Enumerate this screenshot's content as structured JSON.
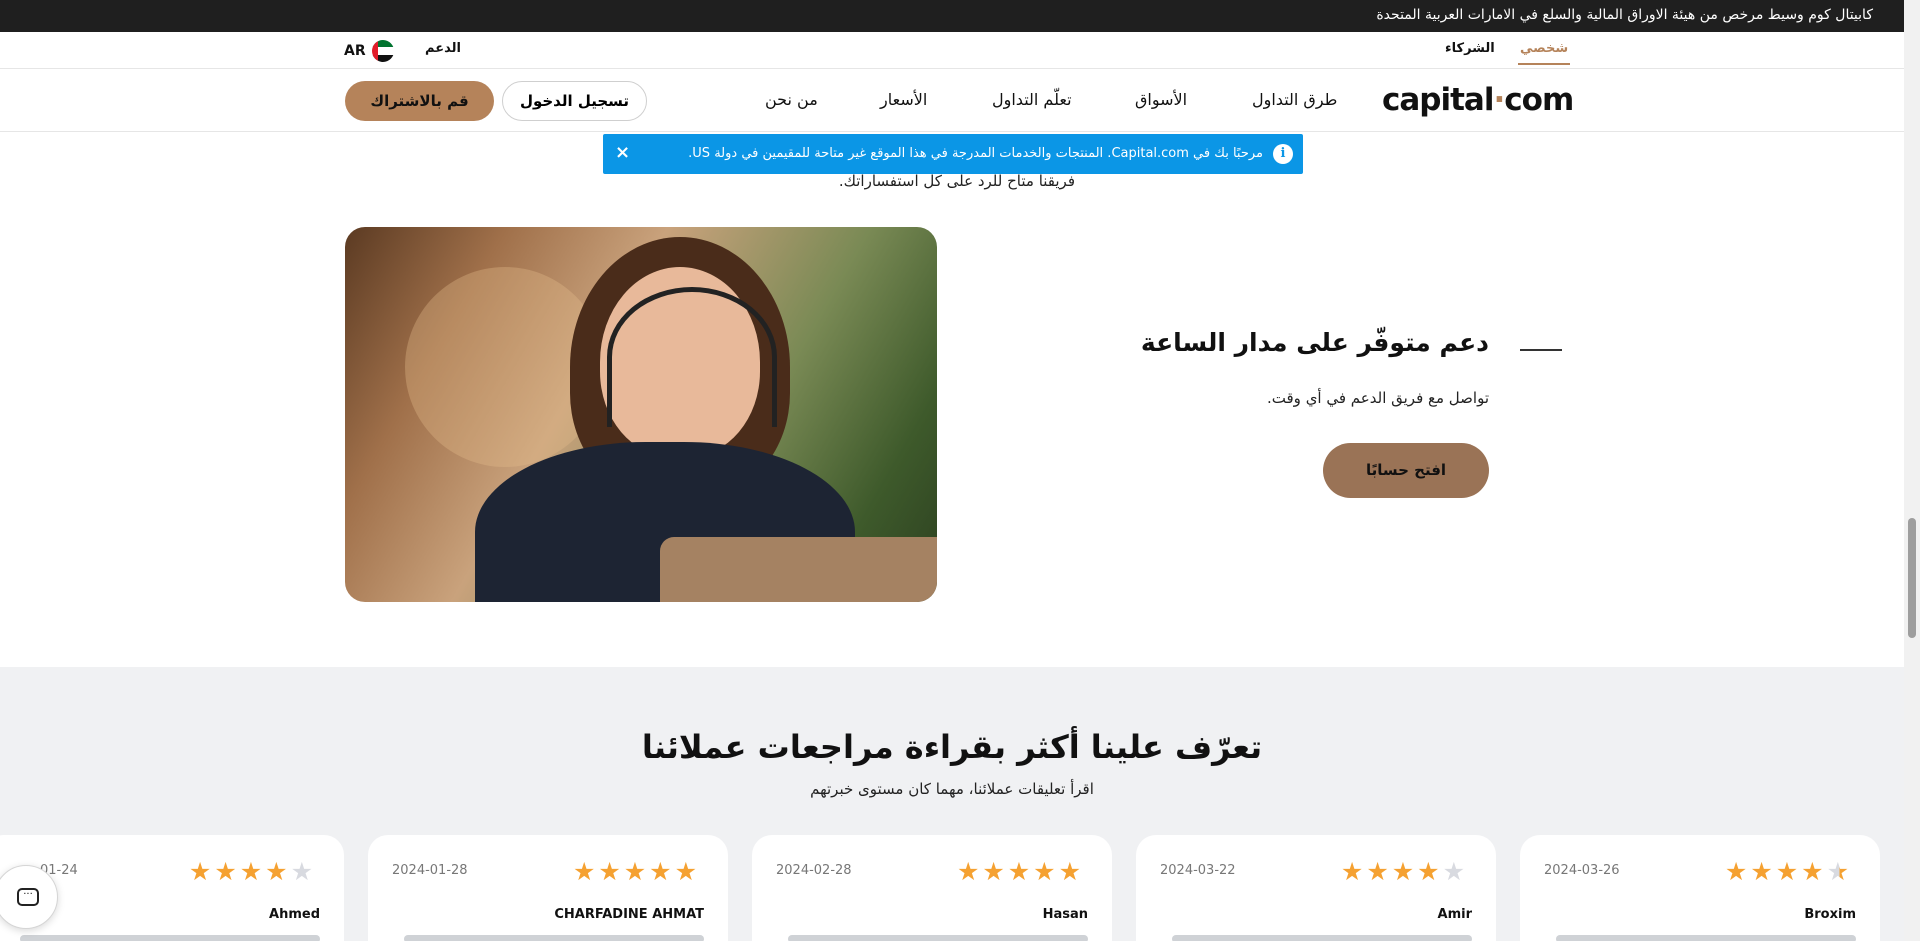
{
  "topbar": {
    "text": "كابيتال كوم وسيط مرخص من هيئة الاوراق المالية والسلع في الامارات العربية المتحدة"
  },
  "subnav": {
    "personal": "شخصي",
    "partners": "الشركاء",
    "support": "الدعم",
    "lang": "AR"
  },
  "nav": {
    "logo_left": "capital",
    "logo_dot": "·",
    "logo_right": "com",
    "items": [
      "طرق التداول",
      "الأسواق",
      "تعلّم التداول",
      "الأسعار",
      "من نحن"
    ],
    "login": "تسجيل الدخول",
    "signup": "قم بالاشتراك"
  },
  "info_banner": {
    "message": "مرحبًا بك في Capital.com. المنتجات والخدمات المدرجة في هذا الموقع غير متاحة للمقيمين في دولة US.",
    "close": "×"
  },
  "lead_text": "فريقنا متاح للرد على كل استفساراتك.",
  "support_section": {
    "title": "دعم متوفّر على مدار الساعة",
    "subtitle": "تواصل مع فريق الدعم في أي وقت.",
    "button": "افتح حسابًا"
  },
  "reviews": {
    "title": "تعرّف علينا أكثر بقراءة مراجعات عملائنا",
    "subtitle": "اقرأ تعليقات عملائنا، مهما كان مستوى خبرتهم",
    "cards": [
      {
        "date": "2024-03-26",
        "name": "Broxim",
        "stars": 4.5
      },
      {
        "date": "2024-03-22",
        "name": "Amir",
        "stars": 4
      },
      {
        "date": "2024-02-28",
        "name": "Hasan",
        "stars": 5
      },
      {
        "date": "2024-01-28",
        "name": "CHARFADINE AHMAT",
        "stars": 5
      },
      {
        "date": "01-24",
        "name": "Ahmed",
        "stars": 4
      }
    ]
  },
  "colors": {
    "accent": "#b5835a",
    "info": "#0b96e6",
    "star": "#f5a131",
    "dark_bar": "#1f1f1f"
  },
  "icons": {
    "info": "info-icon",
    "close": "close-icon",
    "chat": "chat-icon",
    "flag": "uae-flag-icon"
  }
}
